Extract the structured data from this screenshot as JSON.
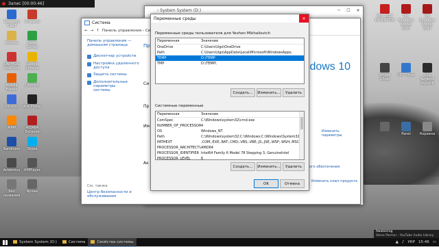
{
  "recording": {
    "label": "Запис [00:00:46]"
  },
  "desktop_left": [
    {
      "label": "Samsung\nKies3",
      "color": "#2a6bd1"
    },
    {
      "label": "CCleaner",
      "color": "#c63b2b"
    },
    {
      "label": "Recuva",
      "color": "#d9b24a"
    },
    {
      "label": "Razer\nCortex",
      "color": "#2ea043"
    },
    {
      "label": "DAEMON\nTools Lite",
      "color": "#cc3333"
    },
    {
      "label": "Google\nChrome",
      "color": "#e8b400"
    },
    {
      "label": "Mozilla\nFirefox",
      "color": "#e66000"
    },
    {
      "label": "uTorrent",
      "color": "#4caf50"
    },
    {
      "label": "UltraISO",
      "color": "#3d6bd8"
    },
    {
      "label": "Ace Player",
      "color": "#222222"
    },
    {
      "label": "AIMP",
      "color": "#ff8800"
    },
    {
      "label": "AIDA64\nExtreme",
      "color": "#b31f1f"
    },
    {
      "label": "Bandicam",
      "color": "#1e4fa8"
    },
    {
      "label": "Skype",
      "color": "#00aff0"
    },
    {
      "label": "Avidemux",
      "color": "#4a4a4a"
    },
    {
      "label": "КМPlayer",
      "color": "#555555"
    },
    {
      "label": "Без\nназвания",
      "color": "#777777"
    },
    {
      "label": "Ярлык",
      "color": "#666666"
    }
  ],
  "desktop_right": [
    {
      "label": "PES 2017\nEVOLUTION",
      "color": "#c61f1f"
    },
    {
      "label": "Pro Evolution\nSoccer 2017",
      "color": "#b01a1a"
    },
    {
      "label": "Pro Evolution\nSoccer 2017",
      "color": "#a51818"
    },
    {
      "label": "Sniper\nGhost",
      "color": "#444444"
    },
    {
      "label": "CPT Timer",
      "color": "#3377cc"
    },
    {
      "label": "USB Network\nJoystick",
      "color": "#2b2b2b"
    },
    {
      "label": "",
      "color": "#666666"
    },
    {
      "label": "Panel",
      "color": "#3a6ea5"
    },
    {
      "label": "Корзина",
      "color": "#888888"
    }
  ],
  "control_panel": {
    "title": "Система",
    "breadcrumb": "Панель управления  ›  Си",
    "home_link": "Панель управления —\nдомашняя страница",
    "nav": [
      "Диспетчер устройств",
      "Настройка удаленного\nдоступа",
      "Защита системы",
      "Дополнительные параметры\nсистемы"
    ],
    "see_also": "См. также",
    "see_also_link": "Центр безопасности и\nобслуживания"
  },
  "sys_props": {
    "title": "Свойства системы",
    "side_labels": [
      "Пр",
      "Си",
      "Пр",
      "Им",
      "Ак"
    ],
    "win10": "indows 10",
    "change_params": "Изменить\nпараметры",
    "ms_license": "ого обеспечения",
    "change_key": "Изменить ключ продукта"
  },
  "env_window": {
    "title": "Переменные среды",
    "user_title": "Переменные среды пользователя для Yevhen Mikhailovich",
    "col_var": "Переменная",
    "col_val": "Значение",
    "user_vars": [
      {
        "name": "OneDrive",
        "value": "C:\\Users\\Ugo\\OneDrive"
      },
      {
        "name": "Path",
        "value": "C:\\Users\\Ugo\\AppData\\Local\\Microsoft\\WindowsApps;"
      },
      {
        "name": "TEMP",
        "value": "D:\\TEMP"
      },
      {
        "name": "TMP",
        "value": "D:\\TEMP\\"
      }
    ],
    "selected_user_index": 2,
    "btn_new": "Создать...",
    "btn_edit": "Изменить...",
    "btn_delete": "Удалить",
    "sys_title": "Системные переменные",
    "sys_vars": [
      {
        "name": "ComSpec",
        "value": "C:\\Windows\\system32\\cmd.exe"
      },
      {
        "name": "NUMBER_OF_PROCESSORS",
        "value": "4"
      },
      {
        "name": "OS",
        "value": "Windows_NT"
      },
      {
        "name": "Path",
        "value": "C:\\Windows\\system32;C:\\Windows;C:\\Windows\\System32\\Wb..."
      },
      {
        "name": "PATHEXT",
        "value": ".COM;.EXE;.BAT;.CMD;.VBS;.VBE;.JS;.JSE;.WSF;.WSH;.MSC"
      },
      {
        "name": "PROCESSOR_ARCHITECTU...",
        "value": "AMD64"
      },
      {
        "name": "PROCESSOR_IDENTIFIER",
        "value": "Intel64 Family 6 Model 78 Stepping 3, GenuineIntel"
      },
      {
        "name": "PROCESSOR_LEVEL",
        "value": "6"
      }
    ],
    "btn_ok": "OK",
    "btn_cancel": "Отмена"
  },
  "behind_window": {
    "title": "System System (D:)",
    "path": "›  System System (D:)"
  },
  "taskbar": {
    "items": [
      {
        "label": "System System (D:)",
        "active": false
      },
      {
        "label": "Система",
        "active": false
      },
      {
        "label": "Свойства системы",
        "active": true
      }
    ],
    "lang": "УКР",
    "time": "15:46"
  },
  "toast": {
    "line1": "Awakening",
    "line2": "Steve Parmer - YouTube Audio Library"
  }
}
